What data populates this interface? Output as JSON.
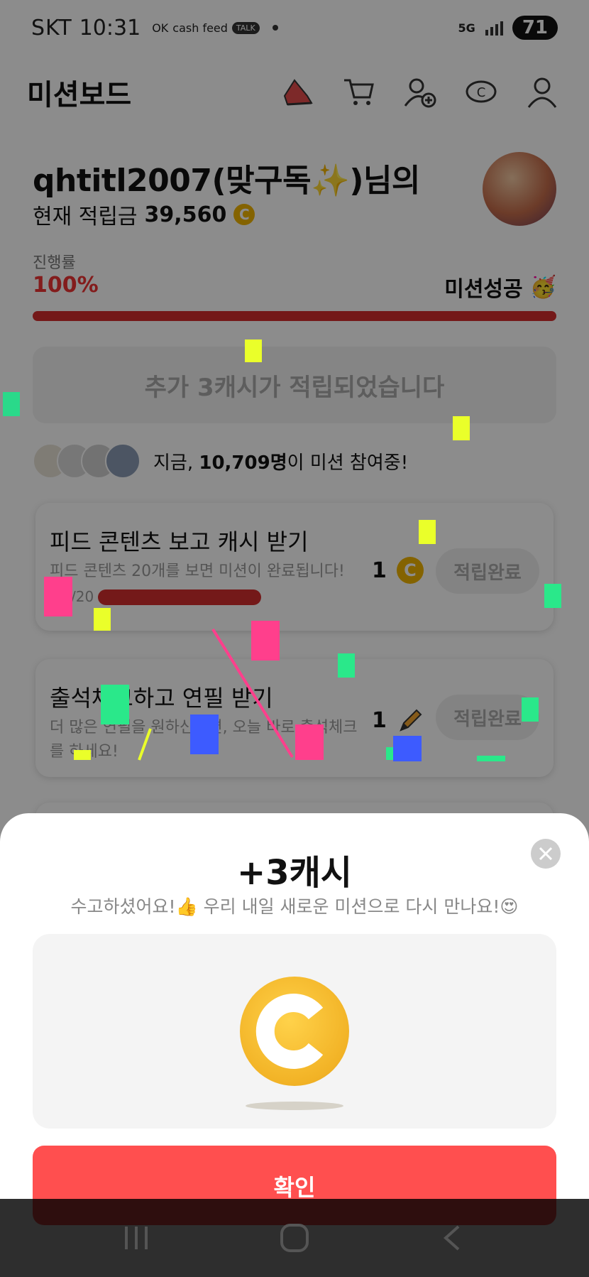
{
  "status_bar": {
    "carrier": "SKT",
    "time": "10:31",
    "apps": [
      "OK",
      "cash feed",
      "TALK"
    ],
    "network": "5G",
    "battery": "71"
  },
  "header": {
    "title": "미션보드",
    "icons": [
      "sneaker-icon",
      "cart-icon",
      "add-friend-icon",
      "cash-icon",
      "profile-icon"
    ]
  },
  "user": {
    "greeting": "qhtitl2007(맞구독✨)님의",
    "balance_label": "현재 적립금",
    "balance": "39,560",
    "coin_symbol": "C"
  },
  "progress": {
    "label": "진행률",
    "value": "100%",
    "fraction": 1.0,
    "status": "미션성공",
    "status_emoji": "🥳"
  },
  "bonus_text": "추가 3캐시가 적립되었습니다",
  "participants": {
    "prefix": "지금, ",
    "count": "10,709명",
    "suffix": "이 미션 참여중!"
  },
  "missions": [
    {
      "title": "피드 콘텐츠 보고 캐시 받기",
      "desc": "피드 콘텐츠 20개를 보면 미션이 완료됩니다!",
      "progress": "/20",
      "reward": "1",
      "button": "적립완료"
    },
    {
      "title": "출석체크하고 연필 받기",
      "desc": "더 많은 연필을 원하신다면, 오늘 바로 출석체크를 하세요!",
      "reward": "1",
      "button": "적립완료"
    }
  ],
  "modal": {
    "title": "+3캐시",
    "subtitle": "수고하셨어요!👍 우리 내일 새로운 미션으로 다시 만나요!😍",
    "confirm": "확인",
    "coin_symbol": "C"
  },
  "colors": {
    "accent": "#ff4f4f",
    "progress": "#d32f2f",
    "coin": "#f2b326"
  }
}
